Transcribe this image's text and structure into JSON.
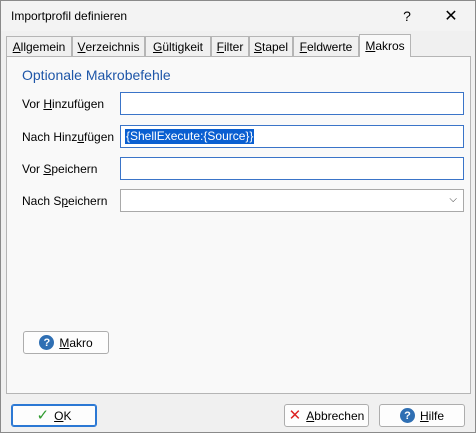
{
  "window": {
    "title": "Importprofil definieren",
    "help_glyph": "?",
    "close_glyph": "✕"
  },
  "tabs": [
    {
      "label": "Allgemein",
      "underline": "A",
      "rest": "llgemein",
      "active": false
    },
    {
      "label": "Verzeichnis",
      "underline": "V",
      "rest": "erzeichnis",
      "active": false
    },
    {
      "label": "Gültigkeit",
      "underline": "G",
      "rest": "ültigkeit",
      "active": false
    },
    {
      "label": "Filter",
      "underline": "F",
      "rest": "ilter",
      "active": false
    },
    {
      "label": "Stapel",
      "underline": "S",
      "rest": "tapel",
      "active": false
    },
    {
      "label": "Feldwerte",
      "underline": "F",
      "rest": "eldwerte",
      "active": false
    },
    {
      "label": "Makros",
      "underline": "M",
      "rest": "akros",
      "active": true
    }
  ],
  "section": {
    "title": "Optionale Makrobefehle"
  },
  "fields": {
    "vor_hinzufuegen": {
      "label_pre": "Vor ",
      "label_ul": "H",
      "label_post": "inzufügen",
      "value": ""
    },
    "nach_hinzufuegen": {
      "label_pre": "Nach Hinz",
      "label_ul": "u",
      "label_post": "fügen",
      "value": "{ShellExecute:{Source}}"
    },
    "vor_speichern": {
      "label_pre": "Vor ",
      "label_ul": "S",
      "label_post": "peichern",
      "value": ""
    },
    "nach_speichern": {
      "label_pre": "Nach S",
      "label_ul": "p",
      "label_post": "eichern",
      "value": "",
      "chevron": "⌵"
    }
  },
  "buttons": {
    "makro": {
      "ul": "M",
      "rest": "akro",
      "icon": "?"
    },
    "ok": {
      "ul": "O",
      "rest": "K",
      "icon": "✓"
    },
    "abbrechen": {
      "ul": "A",
      "rest": "bbrechen",
      "icon": "✕"
    },
    "hilfe": {
      "ul": "H",
      "rest": "ilfe",
      "icon": "?"
    }
  },
  "colors": {
    "accent": "#1e56a8",
    "selection": "#0a5fd1",
    "ok_check": "#2e9b2e",
    "cancel_x": "#dd2222",
    "help_icon": "#2f6fb3"
  }
}
